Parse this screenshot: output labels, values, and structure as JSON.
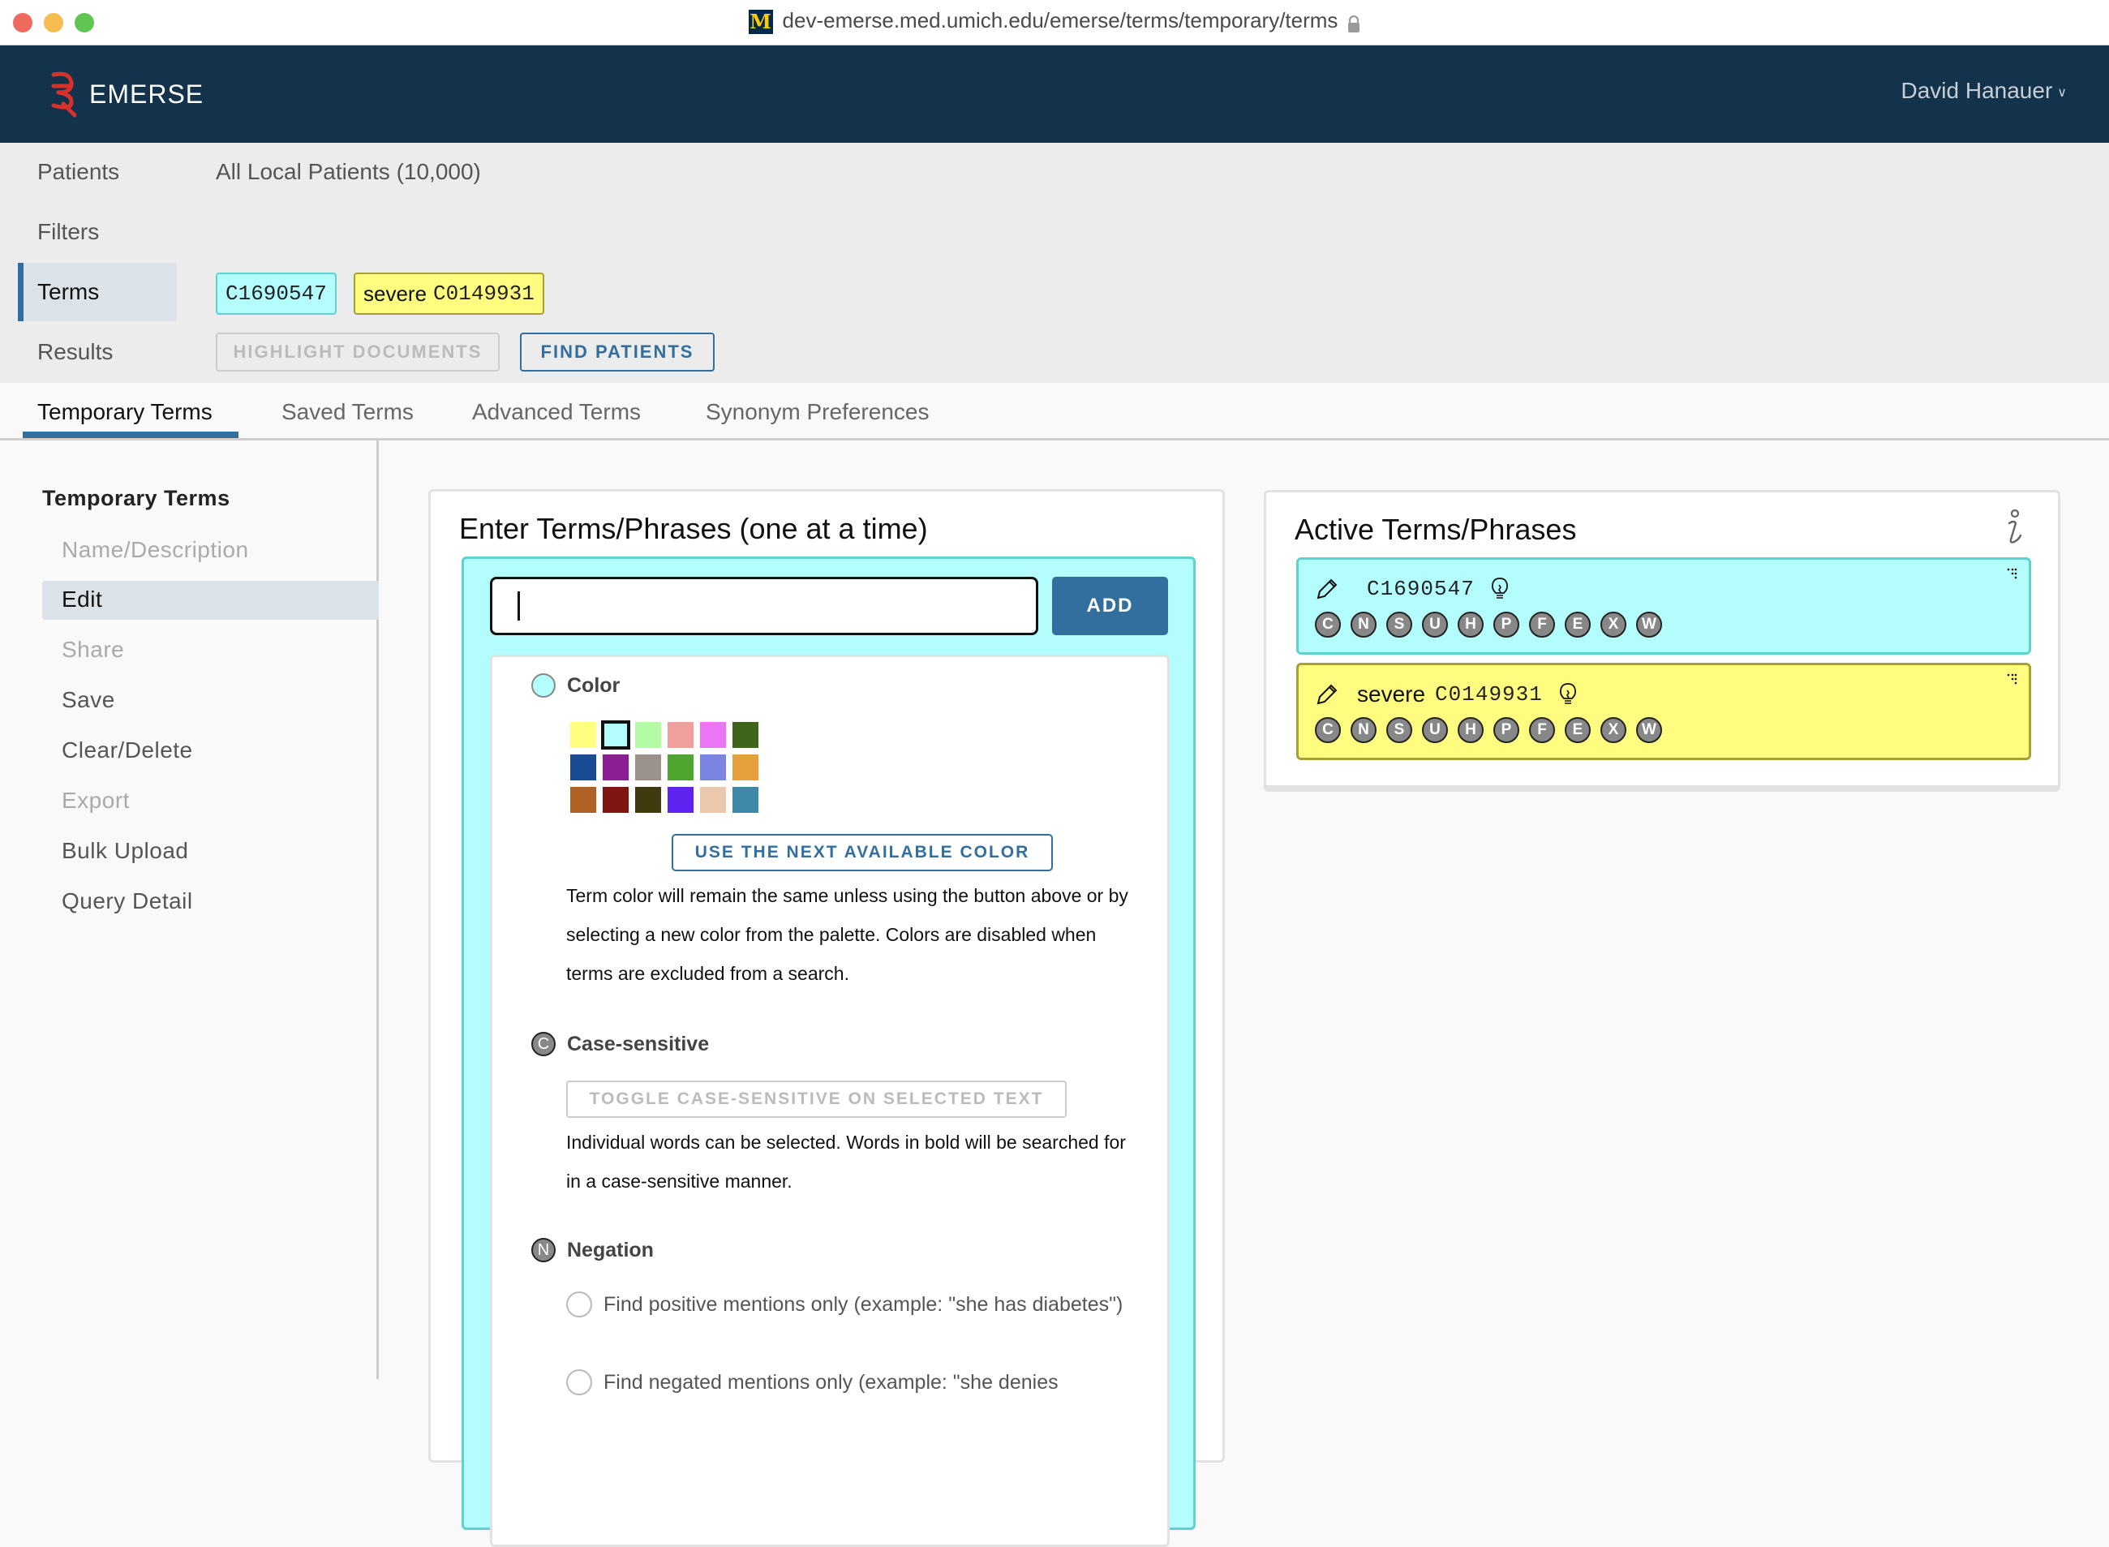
{
  "browser": {
    "url": "dev-emerse.med.umich.edu/emerse/terms/temporary/terms",
    "favicon_letter": "M"
  },
  "header": {
    "app_name": "EMERSE",
    "user_name": "David Hanauer",
    "user_chevron": "⌄"
  },
  "summary": {
    "patients_label": "Patients",
    "patients_value": "All Local Patients (10,000)",
    "filters_label": "Filters",
    "terms_label": "Terms",
    "results_label": "Results",
    "term_chips": [
      {
        "word": "",
        "code": "C1690547",
        "color": "#b4fdfd",
        "border": "#5fd1d1"
      },
      {
        "word": "severe",
        "code": "C0149931",
        "color": "#fffd7f",
        "border": "#a6a037"
      }
    ],
    "highlight_documents_label": "HIGHLIGHT DOCUMENTS",
    "find_patients_label": "FIND PATIENTS"
  },
  "tabs": [
    {
      "label": "Temporary Terms",
      "active": true
    },
    {
      "label": "Saved Terms",
      "active": false
    },
    {
      "label": "Advanced Terms",
      "active": false
    },
    {
      "label": "Synonym Preferences",
      "active": false
    }
  ],
  "sidenav": {
    "title": "Temporary Terms",
    "items": [
      {
        "label": "Name/Description",
        "state": "disabled"
      },
      {
        "label": "Edit",
        "state": "active"
      },
      {
        "label": "Share",
        "state": "disabled"
      },
      {
        "label": "Save",
        "state": "enabled"
      },
      {
        "label": "Clear/Delete",
        "state": "enabled"
      },
      {
        "label": "Export",
        "state": "disabled"
      },
      {
        "label": "Bulk Upload",
        "state": "enabled"
      },
      {
        "label": "Query Detail",
        "state": "enabled"
      }
    ]
  },
  "entry": {
    "title": "Enter Terms/Phrases (one at a time)",
    "input_value": "",
    "add_label": "ADD",
    "color_label": "Color",
    "palette": [
      "#ffff80",
      "#b4fdfd",
      "#b4fca4",
      "#f19f9d",
      "#ec75f6",
      "#40641b",
      "#194a94",
      "#8c1f95",
      "#9b918b",
      "#4ea52f",
      "#7c84e1",
      "#e6a13c",
      "#b06224",
      "#7e1711",
      "#403a0f",
      "#5f24f0",
      "#eac7ad",
      "#3e89a7"
    ],
    "selected_color": "#b4fdfd",
    "next_color_label": "USE THE NEXT AVAILABLE COLOR",
    "color_help": "Term color will remain the same unless using the button above or by selecting a new color from the palette. Colors are disabled when terms are excluded from a search.",
    "case_label": "Case-sensitive",
    "case_badge": "C",
    "toggle_case_label": "TOGGLE CASE-SENSITIVE ON SELECTED TEXT",
    "case_help": "Individual words can be selected. Words in bold will be searched for in a case-sensitive manner.",
    "negation_label": "Negation",
    "negation_badge": "N",
    "negation_options": [
      "Find positive mentions only (example: \"she has diabetes\")",
      "Find negated mentions only (example: \"she denies"
    ]
  },
  "active": {
    "title": "Active Terms/Phrases",
    "flags": [
      "C",
      "N",
      "S",
      "U",
      "H",
      "P",
      "F",
      "E",
      "X",
      "W"
    ],
    "terms": [
      {
        "word": "",
        "code": "C1690547",
        "color": "#b4fdfd",
        "border": "#5fd1d1"
      },
      {
        "word": "severe",
        "code": "C0149931",
        "color": "#fffd7f",
        "border": "#a6a037"
      }
    ]
  }
}
